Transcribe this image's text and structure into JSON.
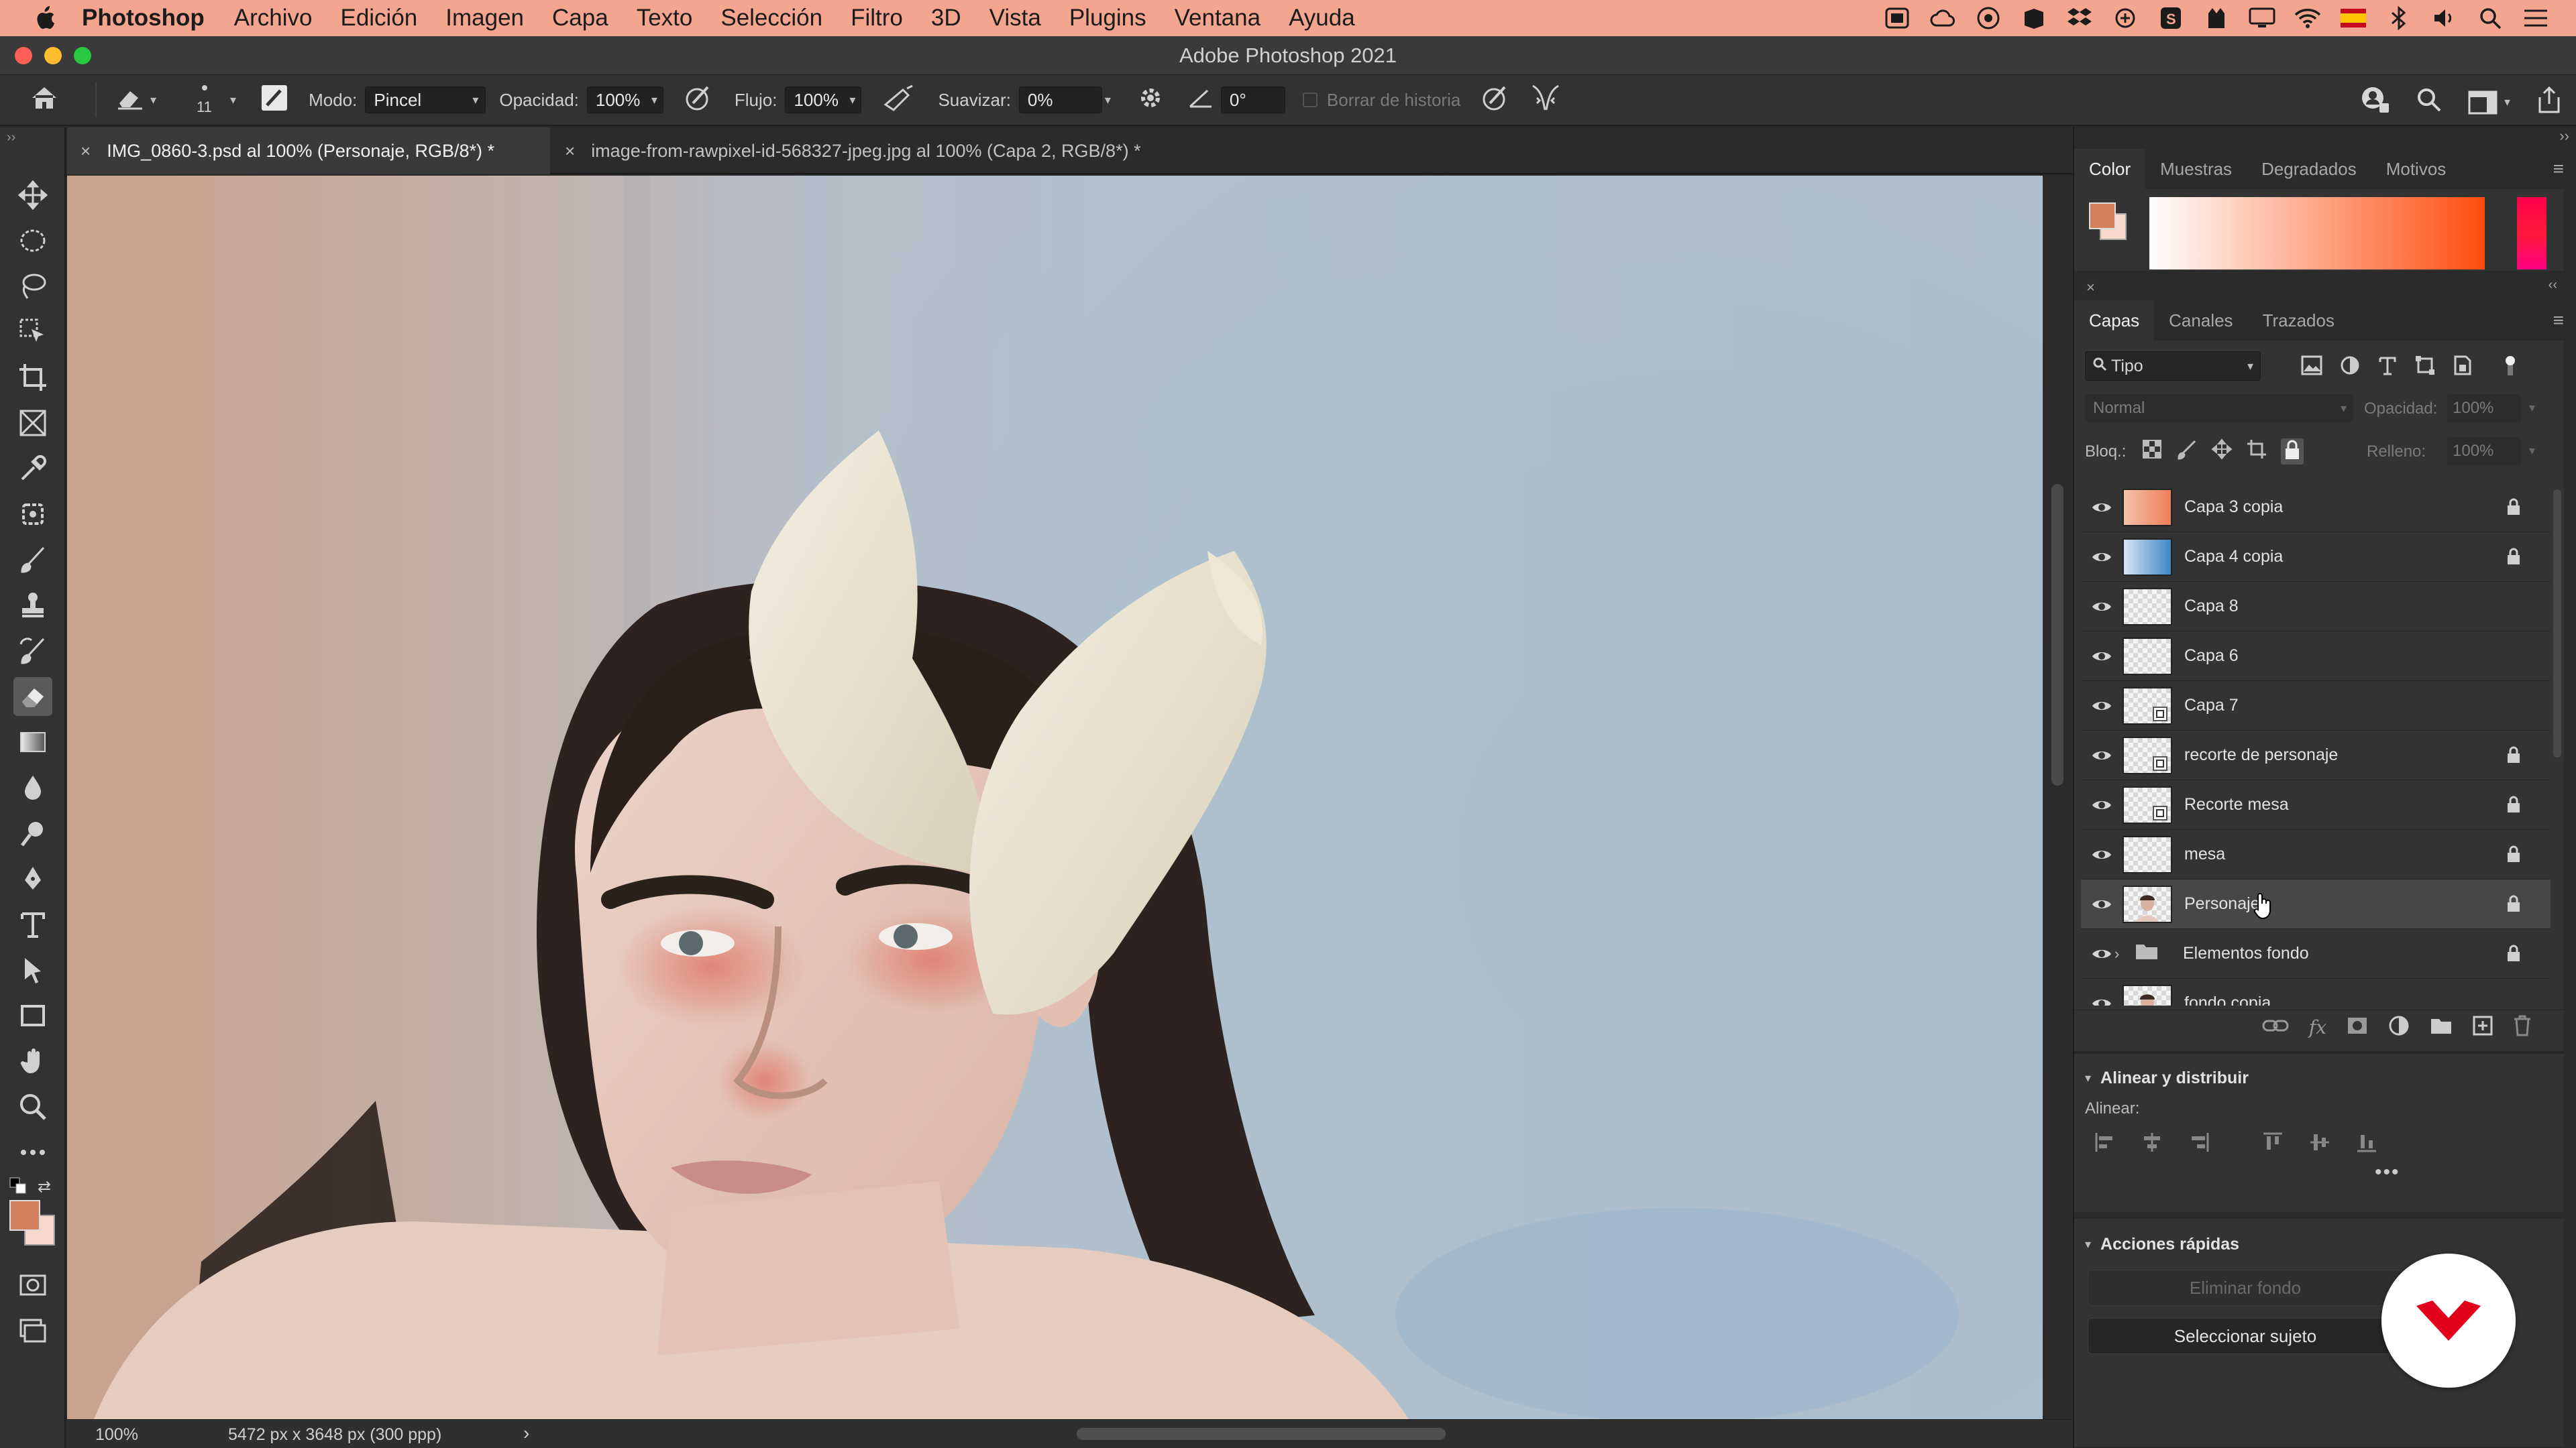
{
  "menubar": {
    "app_name": "Photoshop",
    "items": [
      "Archivo",
      "Edición",
      "Imagen",
      "Capa",
      "Texto",
      "Selección",
      "Filtro",
      "3D",
      "Vista",
      "Plugins",
      "Ventana",
      "Ayuda"
    ],
    "bg_color": "#f4a58f",
    "status_icons": [
      "screen-share-icon",
      "creative-cloud-icon",
      "eye-icon",
      "music-icon",
      "dropbox-icon",
      "sync-icon",
      "s-app-icon",
      "bear-icon",
      "display-icon",
      "wifi-icon",
      "spanish-flag-icon",
      "bluetooth-icon",
      "volume-icon",
      "search-icon",
      "control-center-icon"
    ]
  },
  "window": {
    "title": "Adobe Photoshop 2021"
  },
  "options_bar": {
    "brush_size": "11",
    "mode_label": "Modo:",
    "mode_value": "Pincel",
    "opacity_label": "Opacidad:",
    "opacity_value": "100%",
    "flow_label": "Flujo:",
    "flow_value": "100%",
    "smoothing_label": "Suavizar:",
    "smoothing_value": "0%",
    "angle_value": "0°",
    "history_label": "Borrar de historia"
  },
  "tabs": [
    {
      "label": "IMG_0860-3.psd al 100% (Personaje, RGB/8*) *",
      "active": true
    },
    {
      "label": "image-from-rawpixel-id-568327-jpeg.jpg al 100% (Capa 2, RGB/8*) *",
      "active": false
    }
  ],
  "status_bar": {
    "zoom": "100%",
    "doc_info": "5472 px x 3648 px (300 ppp)"
  },
  "color_panel": {
    "tabs": [
      "Color",
      "Muestras",
      "Degradados",
      "Motivos"
    ],
    "foreground": "#d4805f",
    "background": "#f6d9cc",
    "spectrum_hue": "#ff4d0f"
  },
  "layers_panel": {
    "tabs": [
      "Capas",
      "Canales",
      "Trazados"
    ],
    "filter_value": "Tipo",
    "blend_mode": "Normal",
    "opacity_label": "Opacidad:",
    "opacity_value": "100%",
    "lock_label": "Bloq.:",
    "fill_label": "Relleno:",
    "fill_value": "100%",
    "layers": [
      {
        "name": "Capa 3 copia",
        "locked": true,
        "thumb": "warm-gradient",
        "selected": false
      },
      {
        "name": "Capa 4 copia",
        "locked": true,
        "thumb": "blue-gradient",
        "selected": false
      },
      {
        "name": "Capa 8",
        "locked": false,
        "thumb": "transparent",
        "selected": false
      },
      {
        "name": "Capa 6",
        "locked": false,
        "thumb": "transparent",
        "selected": false
      },
      {
        "name": "Capa 7",
        "locked": false,
        "thumb": "smart-object",
        "selected": false
      },
      {
        "name": "recorte de personaje",
        "locked": true,
        "thumb": "smart-object",
        "selected": false
      },
      {
        "name": "Recorte mesa",
        "locked": true,
        "thumb": "smart-object",
        "selected": false
      },
      {
        "name": "mesa",
        "locked": true,
        "thumb": "transparent",
        "selected": false
      },
      {
        "name": "Personaje",
        "locked": true,
        "thumb": "portrait",
        "selected": true
      },
      {
        "name": "Elementos fondo",
        "locked": true,
        "thumb": "folder",
        "selected": false
      },
      {
        "name": "fondo copia",
        "locked": false,
        "thumb": "portrait",
        "selected": false
      }
    ]
  },
  "properties": {
    "align_section": "Alinear y distribuir",
    "align_label": "Alinear:",
    "quick_actions": "Acciones rápidas",
    "remove_bg": "Eliminar fondo",
    "select_subject": "Seleccionar sujeto"
  }
}
